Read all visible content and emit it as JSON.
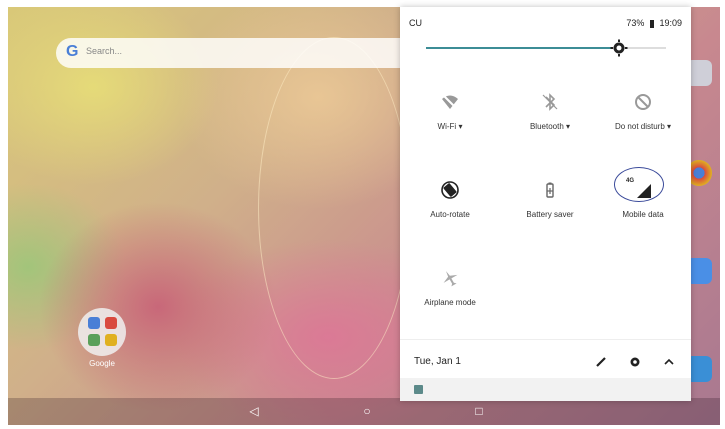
{
  "home": {
    "search_placeholder": "Search...",
    "folder_label": "Google"
  },
  "status_bar": {
    "carrier": "CU",
    "battery": "73%",
    "time": "19:09"
  },
  "brightness": {
    "level": 0.78
  },
  "tiles": [
    {
      "label": "Wi-Fi",
      "dropdown": "▾",
      "icon": "wifi-off-icon"
    },
    {
      "label": "Bluetooth",
      "dropdown": "▾",
      "icon": "bluetooth-off-icon"
    },
    {
      "label": "Do not disturb",
      "dropdown": "▾",
      "icon": "do-not-disturb-icon"
    },
    {
      "label": "Auto-rotate",
      "icon": "auto-rotate-icon"
    },
    {
      "label": "Battery saver",
      "icon": "battery-saver-icon"
    },
    {
      "label": "Mobile data",
      "icon": "mobile-data-icon",
      "badge": "4G"
    },
    {
      "label": "Airplane mode",
      "icon": "airplane-mode-icon"
    }
  ],
  "footer": {
    "date": "Tue, Jan 1"
  },
  "colors": {
    "accent": "#3c8d96",
    "annotation": "#3a4a9a"
  }
}
